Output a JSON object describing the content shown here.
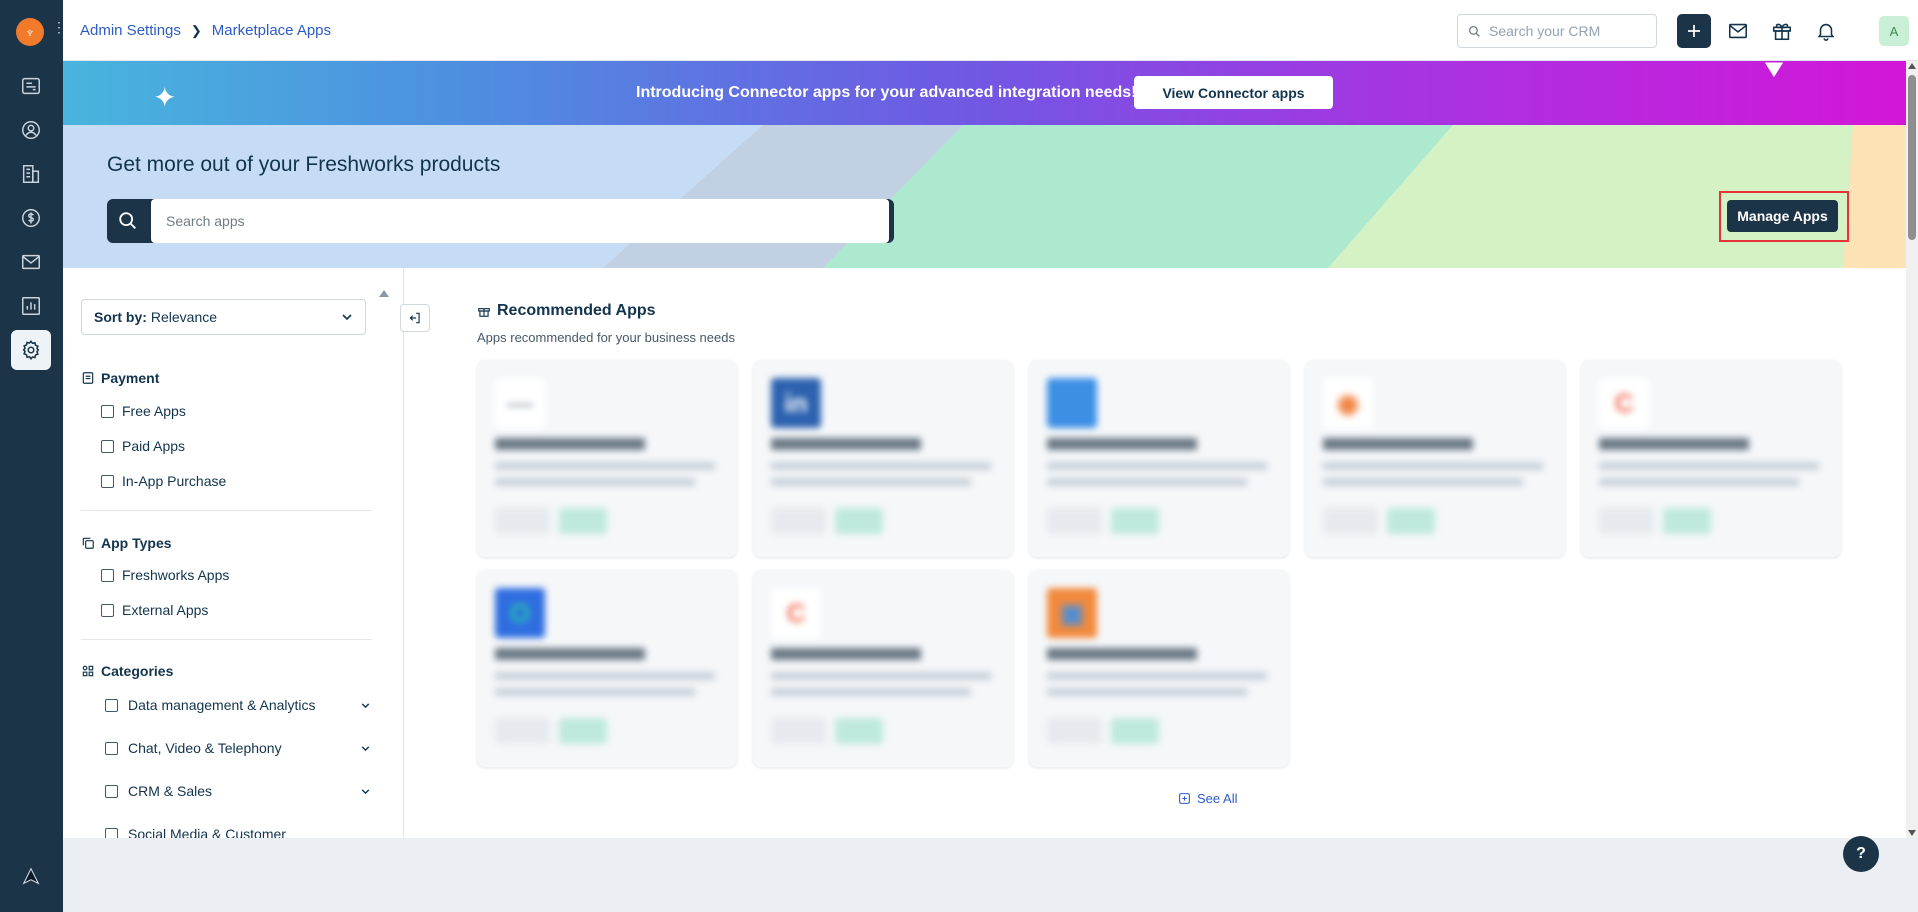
{
  "breadcrumb": {
    "parent": "Admin Settings",
    "current": "Marketplace Apps"
  },
  "topbar": {
    "search_placeholder": "Search your CRM",
    "avatar_letter": "A"
  },
  "banner": {
    "text": "Introducing Connector apps for your advanced integration needs!",
    "button": "View Connector apps"
  },
  "hero": {
    "title": "Get more out of your Freshworks products",
    "search_placeholder": "Search apps",
    "manage_button": "Manage Apps"
  },
  "filters": {
    "sort_label": "Sort by:",
    "sort_value": "Relevance",
    "payment": {
      "title": "Payment",
      "options": [
        "Free Apps",
        "Paid Apps",
        "In-App Purchase"
      ]
    },
    "app_types": {
      "title": "App Types",
      "options": [
        "Freshworks Apps",
        "External Apps"
      ]
    },
    "categories": {
      "title": "Categories",
      "options": [
        "Data management & Analytics",
        "Chat, Video & Telephony",
        "CRM & Sales",
        "Social Media & Customer"
      ]
    }
  },
  "recommended": {
    "title": "Recommended Apps",
    "subtitle": "Apps recommended for your business needs",
    "see_all": "See All",
    "cards": [
      {
        "logo_bg": "#ffffff",
        "logo_fg": "#9aa5af",
        "logo_text": "—"
      },
      {
        "logo_bg": "#2d62b0",
        "logo_fg": "#ffffff",
        "logo_text": "in"
      },
      {
        "logo_bg": "#3d8fe6",
        "logo_fg": "#ffffff",
        "logo_text": ""
      },
      {
        "logo_bg": "#ffffff",
        "logo_fg": "#f07f3c",
        "logo_text": "◉"
      },
      {
        "logo_bg": "#ffffff",
        "logo_fg": "#f06a4f",
        "logo_text": "C"
      },
      {
        "logo_bg": "#2f6ee0",
        "logo_fg": "#24c7a8",
        "logo_text": "O"
      },
      {
        "logo_bg": "#ffffff",
        "logo_fg": "#f06a4f",
        "logo_text": "C"
      },
      {
        "logo_bg": "#f28a3d",
        "logo_fg": "#4a8ed9",
        "logo_text": "▣"
      }
    ]
  },
  "help": {
    "label": "?"
  }
}
